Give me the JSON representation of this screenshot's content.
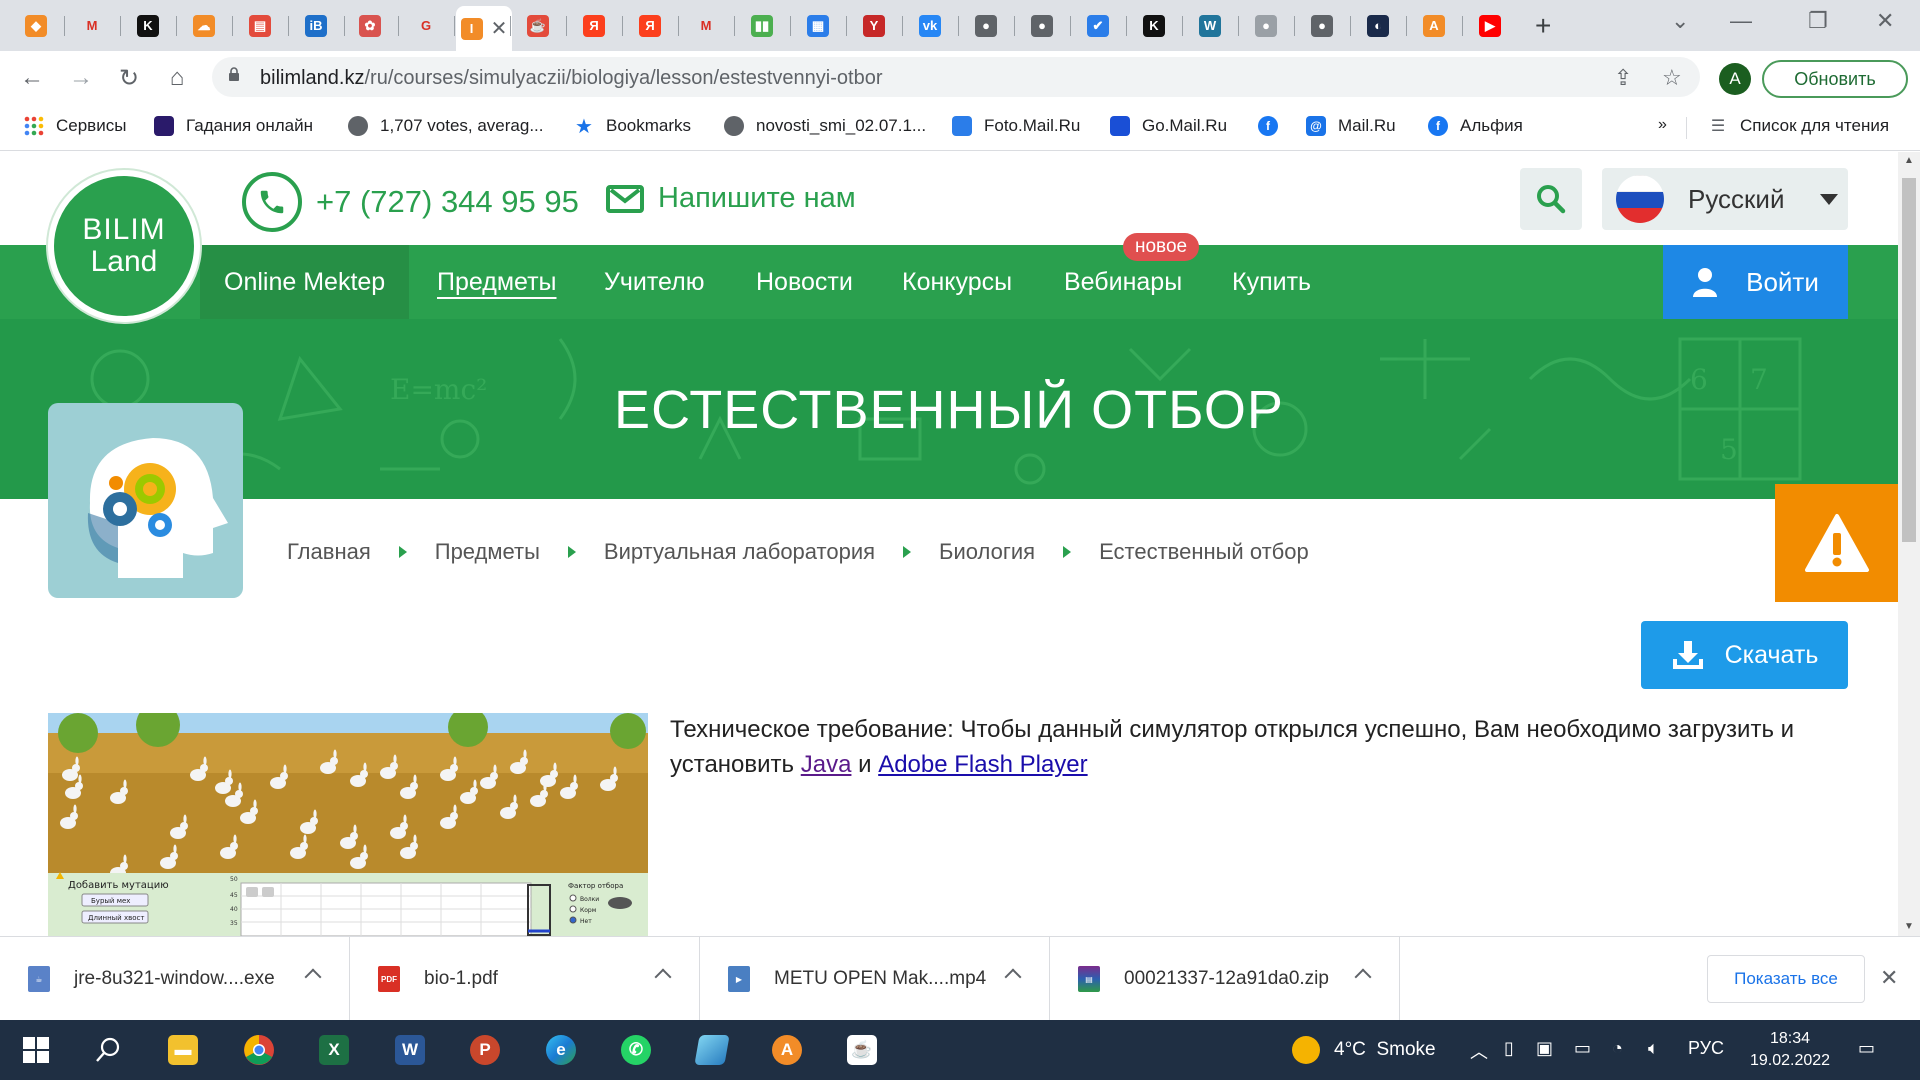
{
  "browser": {
    "tabs": [
      {
        "icon": "brave-like-icon",
        "color": "#f28c28",
        "glyph": "◆"
      },
      {
        "icon": "gmail-icon",
        "color": "#ffffff",
        "glyph": "M"
      },
      {
        "icon": "k-icon",
        "color": "#111111",
        "glyph": "K"
      },
      {
        "icon": "cloud-icon",
        "color": "#f28c28",
        "glyph": "☁"
      },
      {
        "icon": "document-icon",
        "color": "#e34b3c",
        "glyph": "▤"
      },
      {
        "icon": "ib-icon",
        "color": "#1e6fc9",
        "glyph": "iB"
      },
      {
        "icon": "badge-icon",
        "color": "#d9534f",
        "glyph": "✿"
      },
      {
        "icon": "google-icon",
        "color": "#ffffff",
        "glyph": "G"
      },
      {
        "icon": "bilimland-icon",
        "color": "#f28c28",
        "glyph": "I"
      },
      {
        "icon": "java-icon",
        "color": "#e34b3c",
        "glyph": "☕"
      },
      {
        "icon": "yandex-icon",
        "color": "#fc3f1d",
        "glyph": "Я"
      },
      {
        "icon": "yandex-icon",
        "color": "#fc3f1d",
        "glyph": "Я"
      },
      {
        "icon": "gmail-icon",
        "color": "#ffffff",
        "glyph": "M"
      },
      {
        "icon": "book-icon",
        "color": "#4caf50",
        "glyph": "▮▮"
      },
      {
        "icon": "layout-icon",
        "color": "#2b7de9",
        "glyph": "▦"
      },
      {
        "icon": "yaklass-icon",
        "color": "#c62828",
        "glyph": "Y"
      },
      {
        "icon": "vk-icon",
        "color": "#2787f5",
        "glyph": "vk"
      },
      {
        "icon": "globe-icon",
        "color": "#5f6368",
        "glyph": "●"
      },
      {
        "icon": "globe-icon",
        "color": "#5f6368",
        "glyph": "●"
      },
      {
        "icon": "check-icon",
        "color": "#2b7de9",
        "glyph": "✔"
      },
      {
        "icon": "k-icon",
        "color": "#111111",
        "glyph": "K"
      },
      {
        "icon": "wordpress-icon",
        "color": "#21759b",
        "glyph": "W"
      },
      {
        "icon": "globe-icon",
        "color": "#9aa0a6",
        "glyph": "●"
      },
      {
        "icon": "globe-icon",
        "color": "#5f6368",
        "glyph": "●"
      },
      {
        "icon": "circle-icon",
        "color": "#1a2a4a",
        "glyph": "◐"
      },
      {
        "icon": "rocket-icon",
        "color": "#f28c28",
        "glyph": "A"
      },
      {
        "icon": "youtube-icon",
        "color": "#ff0000",
        "glyph": "▶"
      }
    ],
    "active_tab_index": 8,
    "url_host": "bilimland.kz",
    "url_path": "/ru/courses/simulyaczii/biologiya/lesson/estestvennyi-otbor",
    "profile_initial": "A",
    "update_label": "Обновить",
    "bookmarks": [
      {
        "label": "Сервисы",
        "icon": "apps-grid-icon",
        "color": "#ea4335"
      },
      {
        "label": "Гадания онлайн",
        "icon": "galaxy-icon",
        "color": "#2a1a6a"
      },
      {
        "label": "1,707 votes, averag...",
        "icon": "globe-icon",
        "color": "#5f6368"
      },
      {
        "label": "Bookmarks",
        "icon": "star-icon",
        "color": "#1a73e8"
      },
      {
        "label": "novosti_smi_02.07.1...",
        "icon": "globe-icon",
        "color": "#5f6368"
      },
      {
        "label": "Foto.Mail.Ru",
        "icon": "photo-icon",
        "color": "#2b7de9"
      },
      {
        "label": "Go.Mail.Ru",
        "icon": "search-box-icon",
        "color": "#1a4fd6"
      },
      {
        "label": "",
        "icon": "facebook-icon",
        "color": "#1877f2"
      },
      {
        "label": "Mail.Ru",
        "icon": "at-icon",
        "color": "#1a73e8"
      },
      {
        "label": "Альфия",
        "icon": "facebook-icon",
        "color": "#1877f2"
      }
    ],
    "bookmarks_overflow": "»",
    "reading_list": "Список для чтения"
  },
  "site": {
    "logo_line1": "BILIM",
    "logo_line2": "Land",
    "phone": "+7 (727)  344 95 95",
    "write_us": "Напишите нам",
    "language": "Русский",
    "nav": [
      "Online Mektep",
      "Предметы",
      "Учителю",
      "Новости",
      "Конкурсы",
      "Вебинары",
      "Купить"
    ],
    "nav_badge": "новое",
    "login": "Войти",
    "title": "ЕСТЕСТВЕННЫЙ ОТБОР",
    "breadcrumb": [
      "Главная",
      "Предметы",
      "Виртуальная лаборатория",
      "Биология",
      "Естественный отбор"
    ],
    "download": "Скачать",
    "tech_text_before": "Техническое требование: Чтобы данный симулятор открылся успешно, Вам необходимо загрузить и установить ",
    "tech_link_java": "Java",
    "tech_and": " и ",
    "tech_link_flash": "Adobe Flash Player",
    "sim_panel": {
      "add_mutation": "Добавить мутацию",
      "btn1": "Бурый мех",
      "btn2": "Длинный хвост",
      "factor_title": "Фактор отбора",
      "factor_opts": [
        "Волки",
        "Корм",
        "Нет"
      ],
      "axis_top": "50",
      "axis_ticks": [
        "45",
        "40",
        "35"
      ]
    }
  },
  "downloads": {
    "items": [
      {
        "name": "jre-8u321-window....exe",
        "type": "exe"
      },
      {
        "name": "bio-1.pdf",
        "type": "pdf"
      },
      {
        "name": "METU OPEN Mak....mp4",
        "type": "mp4"
      },
      {
        "name": "00021337-12a91da0.zip",
        "type": "zip"
      }
    ],
    "show_all": "Показать все"
  },
  "taskbar": {
    "weather_temp": "4°C",
    "weather_desc": "Smoke",
    "lang": "РУС",
    "time": "18:34",
    "date": "19.02.2022"
  },
  "colors": {
    "brand_green": "#2aa04e",
    "login_blue": "#1e88e5",
    "download_blue": "#1e9be9",
    "warning_orange": "#f28c00",
    "badge_red": "#e04f4f"
  }
}
